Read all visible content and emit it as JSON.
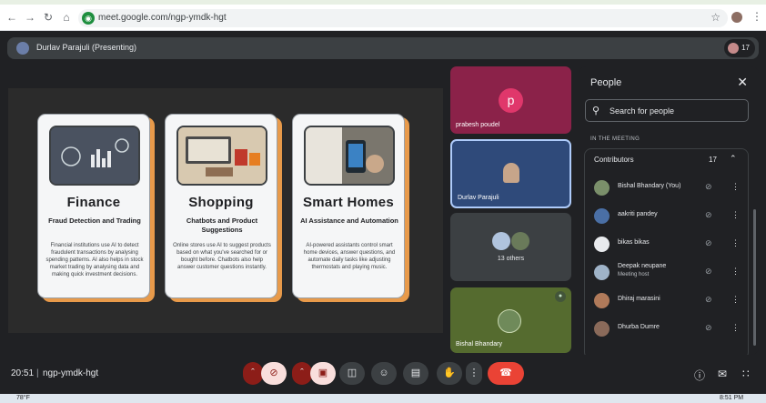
{
  "browser": {
    "url": "meet.google.com/ngp-ymdk-hgt"
  },
  "meet_topbar": {
    "presenting_label": "Durlav Parajuli (Presenting)",
    "participant_count": "17"
  },
  "slide": {
    "cards": [
      {
        "title": "Finance",
        "subtitle": "Fraud Detection and Trading",
        "body": "Financial institutions use AI to detect fraudulent transactions by analysing spending patterns. AI also helps in stock market trading by analysing data and making quick investment decisions.",
        "image_color": "#5a6270"
      },
      {
        "title": "Shopping",
        "subtitle": "Chatbots and Product Suggestions",
        "body": "Online stores use AI to suggest products based on what you've searched for or bought before. Chatbots also help answer customer questions instantly.",
        "image_color": "#b89a7a"
      },
      {
        "title": "Smart Homes",
        "subtitle": "AI Assistance and Automation",
        "body": "AI-powered assistants control smart home devices, answer questions, and automate daily tasks like adjusting thermostats and playing music.",
        "image_color": "#6d6a63"
      }
    ]
  },
  "tiles": [
    {
      "name": "prabesh poudel",
      "initial": "p"
    },
    {
      "name": "Durlav Parajuli"
    },
    {
      "others": "13 others"
    },
    {
      "name": "Bishal Bhandary"
    }
  ],
  "people_panel": {
    "title": "People",
    "search_placeholder": "Search for people",
    "section_label": "IN THE MEETING",
    "group_label": "Contributors",
    "group_count": "17",
    "participants": [
      {
        "name": "Bishal Bhandary (You)",
        "role": "",
        "avatar_color": "#7a8f6a"
      },
      {
        "name": "aakriti pandey",
        "role": "",
        "avatar_color": "#4a6fa5"
      },
      {
        "name": "bikas bikas",
        "role": "",
        "avatar_color": "#e8eaed"
      },
      {
        "name": "Deepak neupane",
        "role": "Meeting host",
        "avatar_color": "#9fb3c8"
      },
      {
        "name": "Dhiraj marasini",
        "role": "",
        "avatar_color": "#b07a5a"
      },
      {
        "name": "Dhurba Dumre",
        "role": "",
        "avatar_color": "#8a6a5a"
      }
    ]
  },
  "bottom_bar": {
    "time": "20:51",
    "meeting_code": "ngp-ymdk-hgt"
  },
  "taskbar": {
    "temperature": "78°F",
    "clock": "8:51 PM"
  },
  "colors": {
    "accent_orange": "#e89a4a",
    "end_call_red": "#ea4335",
    "background": "#202124"
  }
}
